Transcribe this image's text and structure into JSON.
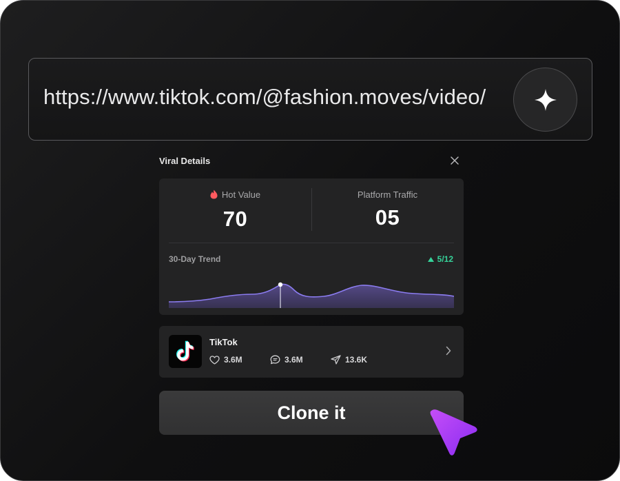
{
  "url_bar": {
    "value": "https://www.tiktok.com/@fashion.moves/video/",
    "action_icon": "sparkle-icon"
  },
  "panel": {
    "title": "Viral Details",
    "close_icon": "close-icon",
    "hot_value": {
      "label": "Hot Value",
      "value": "70",
      "icon": "flame-icon"
    },
    "platform_traffic": {
      "label": "Platform Traffic",
      "value": "05"
    },
    "trend": {
      "label": "30-Day Trend",
      "marker_date": "5/12",
      "direction_icon": "triangle-up-icon",
      "colors": {
        "line": "#8b7cf0",
        "fill": "#4a4070",
        "up": "#36d39a"
      }
    }
  },
  "source": {
    "platform": "TikTok",
    "logo_icon": "tiktok-logo-icon",
    "likes": "3.6M",
    "comments": "3.6M",
    "shares": "13.6K",
    "chevron_icon": "chevron-right-icon"
  },
  "clone_button": {
    "label": "Clone it"
  },
  "colors": {
    "accent_cursor": "#b24cf5",
    "card_bg": "#232324"
  }
}
